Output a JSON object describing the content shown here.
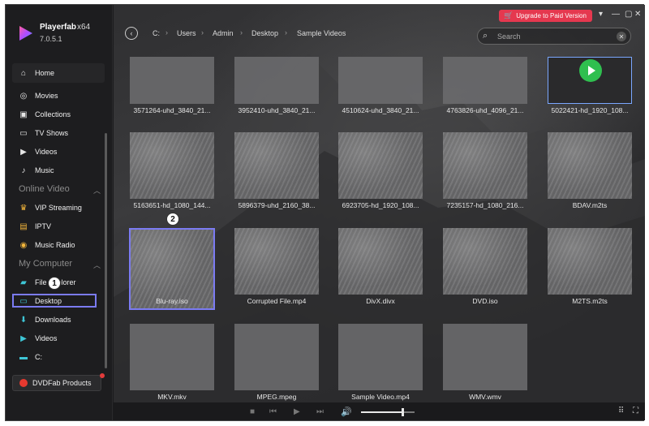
{
  "app": {
    "name": "Playerfab",
    "arch": "x64",
    "version": "7.0.5.1"
  },
  "sidebar": {
    "home": "Home",
    "library": [
      {
        "label": "Movies",
        "icon": "movie-icon"
      },
      {
        "label": "Collections",
        "icon": "collections-icon"
      },
      {
        "label": "TV Shows",
        "icon": "tv-icon"
      },
      {
        "label": "Videos",
        "icon": "video-icon"
      },
      {
        "label": "Music",
        "icon": "music-icon"
      }
    ],
    "online_title": "Online Video",
    "online": [
      {
        "label": "VIP Streaming",
        "icon": "vip-crown-icon"
      },
      {
        "label": "IPTV",
        "icon": "iptv-icon"
      },
      {
        "label": "Music Radio",
        "icon": "radio-icon"
      }
    ],
    "computer_title": "My Computer",
    "computer": [
      {
        "label": "File Explorer",
        "icon": "folder-icon"
      },
      {
        "label": "Desktop",
        "icon": "desktop-icon"
      },
      {
        "label": "Downloads",
        "icon": "download-icon"
      },
      {
        "label": "Videos",
        "icon": "video-folder-icon"
      },
      {
        "label": "C:",
        "icon": "drive-icon"
      }
    ],
    "products_label": "DVDFab Products"
  },
  "header": {
    "upgrade_label": "Upgrade to Paid Version",
    "breadcrumb": [
      "C:",
      "Users",
      "Admin",
      "Desktop",
      "Sample Videos"
    ],
    "search_placeholder": "Search"
  },
  "files_row1": [
    "3571264-uhd_3840_21...",
    "3952410-uhd_3840_21...",
    "4510624-uhd_3840_21...",
    "4763826-uhd_4096_21...",
    "5022421-hd_1920_108..."
  ],
  "files_row2": [
    "5163651-hd_1080_144...",
    "5896379-uhd_2160_38...",
    "6923705-hd_1920_108...",
    "7235157-hd_1080_216...",
    "BDAV.m2ts"
  ],
  "files_row3": [
    "Blu-ray.iso",
    "Corrupted File.mp4",
    "DivX.divx",
    "DVD.iso",
    "M2TS.m2ts"
  ],
  "files_row4": [
    "MKV.mkv",
    "MPEG.mpeg",
    "Sample Video.mp4",
    "WMV.wmv"
  ],
  "callouts": {
    "one": "1",
    "two": "2"
  },
  "player": {
    "volume_fraction": 0.78
  },
  "colors": {
    "accent": "#7b7bf2",
    "upgrade": "#e5384f",
    "play_green": "#2fbf4f"
  }
}
